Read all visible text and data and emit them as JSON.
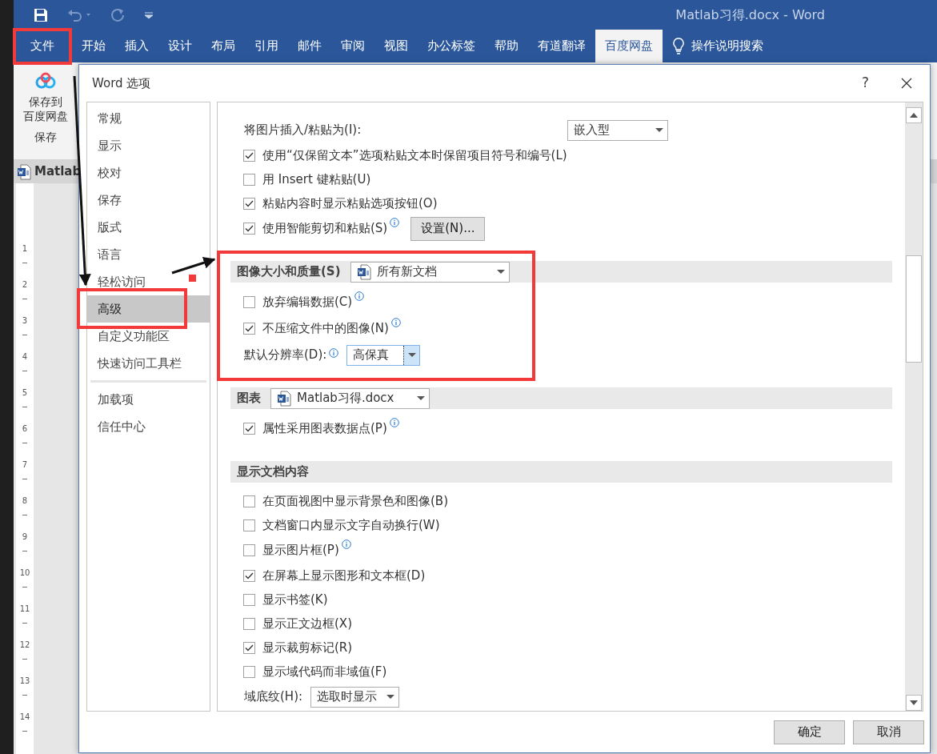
{
  "window": {
    "title": "Matlab习得.docx - Word"
  },
  "ribbon_tabs": [
    {
      "label": "文件",
      "selected": false
    },
    {
      "label": "开始",
      "selected": false
    },
    {
      "label": "插入",
      "selected": false
    },
    {
      "label": "设计",
      "selected": false
    },
    {
      "label": "布局",
      "selected": false
    },
    {
      "label": "引用",
      "selected": false
    },
    {
      "label": "邮件",
      "selected": false
    },
    {
      "label": "审阅",
      "selected": false
    },
    {
      "label": "视图",
      "selected": false
    },
    {
      "label": "办公标签",
      "selected": false
    },
    {
      "label": "帮助",
      "selected": false
    },
    {
      "label": "有道翻译",
      "selected": false
    },
    {
      "label": "百度网盘",
      "selected": true
    }
  ],
  "tell_me": "操作说明搜索",
  "ribbon": {
    "button_lines": [
      "保存到",
      "百度网盘"
    ],
    "group": "保存"
  },
  "document_tab": "Matlab",
  "ruler": [
    "1",
    "2",
    "3",
    "4",
    "5",
    "6",
    "7",
    "8",
    "9",
    "10",
    "11",
    "12",
    "13",
    "14"
  ],
  "dialog": {
    "title": "Word 选项",
    "help": "?",
    "nav_groups": [
      [
        {
          "label": "常规",
          "selected": false
        },
        {
          "label": "显示",
          "selected": false
        },
        {
          "label": "校对",
          "selected": false
        },
        {
          "label": "保存",
          "selected": false
        },
        {
          "label": "版式",
          "selected": false
        },
        {
          "label": "语言",
          "selected": false
        },
        {
          "label": "轻松访问",
          "selected": false
        },
        {
          "label": "高级",
          "selected": true
        },
        {
          "label": "自定义功能区",
          "selected": false
        },
        {
          "label": "快速访问工具栏",
          "selected": false
        }
      ],
      [
        {
          "label": "加载项",
          "selected": false
        },
        {
          "label": "信任中心",
          "selected": false
        }
      ]
    ],
    "rows": [
      {
        "kind": "select",
        "label": "将图片插入/粘贴为(I):",
        "value": "嵌入型"
      },
      {
        "kind": "checkbox",
        "label": "使用“仅保留文本”选项粘贴文本时保留项目符号和编号(L)",
        "checked": true
      },
      {
        "kind": "checkbox",
        "label": "用 Insert 键粘贴(U)",
        "checked": false
      },
      {
        "kind": "checkbox",
        "label": "粘贴内容时显示粘贴选项按钮(O)",
        "checked": true
      },
      {
        "kind": "checkbox",
        "label": "使用智能剪切和粘贴(S)",
        "checked": true,
        "info": true,
        "button": "设置(N)..."
      },
      {
        "kind": "section",
        "label": "图像大小和质量(S)",
        "value": "所有新文档"
      },
      {
        "kind": "checkbox",
        "label": "放弃编辑数据(C)",
        "checked": false,
        "info": true
      },
      {
        "kind": "checkbox",
        "label": "不压缩文件中的图像(N)",
        "checked": true,
        "info": true
      },
      {
        "kind": "select",
        "label": "默认分辨率(D):",
        "info": true,
        "value": "高保真",
        "focused": true
      },
      {
        "kind": "section",
        "label": "图表",
        "value": "Matlab习得.docx"
      },
      {
        "kind": "checkbox",
        "label": "属性采用图表数据点(P)",
        "checked": true,
        "info": true
      },
      {
        "kind": "section",
        "label": "显示文档内容"
      },
      {
        "kind": "checkbox",
        "label": "在页面视图中显示背景色和图像(B)",
        "checked": false
      },
      {
        "kind": "checkbox",
        "label": "文档窗口内显示文字自动换行(W)",
        "checked": false
      },
      {
        "kind": "checkbox",
        "label": "显示图片框(P)",
        "checked": false,
        "info": true
      },
      {
        "kind": "checkbox",
        "label": "在屏幕上显示图形和文本框(D)",
        "checked": true
      },
      {
        "kind": "checkbox",
        "label": "显示书签(K)",
        "checked": false
      },
      {
        "kind": "checkbox",
        "label": "显示正文边框(X)",
        "checked": false
      },
      {
        "kind": "checkbox",
        "label": "显示裁剪标记(R)",
        "checked": true
      },
      {
        "kind": "checkbox",
        "label": "显示域代码而非域值(F)",
        "checked": false
      },
      {
        "kind": "select",
        "label": "域底纹(H):",
        "value": "选取时显示"
      }
    ],
    "buttons": [
      "确定",
      "取消"
    ]
  }
}
